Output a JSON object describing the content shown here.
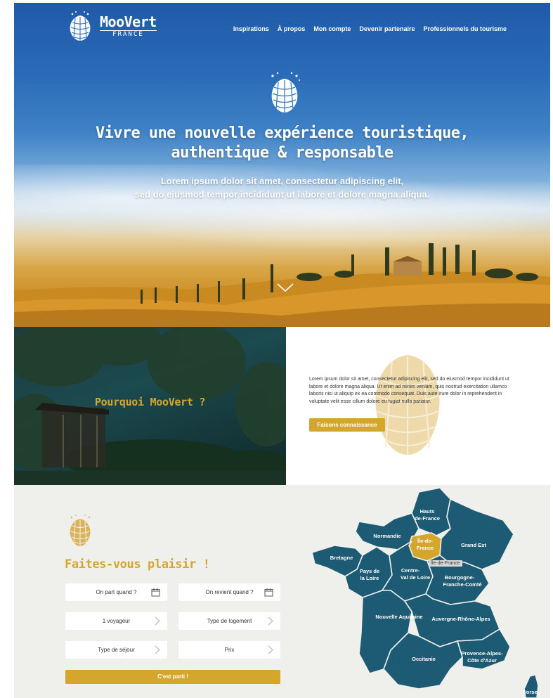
{
  "header": {
    "brand": "MooVert",
    "brand_sub": "FRANCE",
    "nav": [
      "Inspirations",
      "À propos",
      "Mon compte",
      "Devenir partenaire",
      "Professionnels du tourisme"
    ]
  },
  "hero": {
    "title_line1": "Vivre une nouvelle expérience touristique,",
    "title_line2": "authentique & responsable",
    "sub_line1": "Lorem ipsum dolor sit amet, consectetur adipiscing elit,",
    "sub_line2": "sed do eiusmod tempor incididunt ut labore et dolore magna aliqua."
  },
  "why": {
    "title": "Pourquoi MooVert ?",
    "text": "Lorem ipsum dolor sit amet, consectetur adipiscing elit, sed do eiusmod tempor incididunt ut labore et dolore magna aliqua. Ut enim ad minim veniam, quis nostrud exercitation ullamco laboris nisi ut aliquip ex ea commodo consequat. Duis aute irure dolor in reprehenderit in voluptate velit esse cillum dolore eu fugiat nulla pariatur.",
    "button": "Faisons connaissance"
  },
  "search": {
    "title": "Faites-vous plaisir !",
    "fields": {
      "depart": "On part quand ?",
      "retour": "On revient quand ?",
      "voyageurs": "1 voyageur",
      "logement": "Type de logement",
      "sejour": "Type de séjour",
      "prix": "Prix"
    },
    "button": "C'est parti !"
  },
  "map": {
    "regions": {
      "hauts": [
        "Hauts",
        "de-France"
      ],
      "normandie": "Normandie",
      "idf": [
        "Île-de-",
        "France"
      ],
      "grand_est": "Grand Est",
      "bretagne": "Bretagne",
      "pdl": [
        "Pays de",
        "la Loire"
      ],
      "cvl": [
        "Centre-",
        "Val de Loire"
      ],
      "bfc": [
        "Bourgogne-",
        "Franche-Comté"
      ],
      "na": "Nouvelle Aquitaine",
      "ara": "Auvergne-Rhône-Alpes",
      "occitanie": "Occitanie",
      "paca": [
        "Provence-Alpes-",
        "Côte d'Azur"
      ],
      "corse": "Corse"
    },
    "tooltip": "Île-de-France"
  },
  "colors": {
    "gold": "#d4a72c",
    "region_blue": "#1d5a73",
    "region_selected": "#d4a72c"
  }
}
